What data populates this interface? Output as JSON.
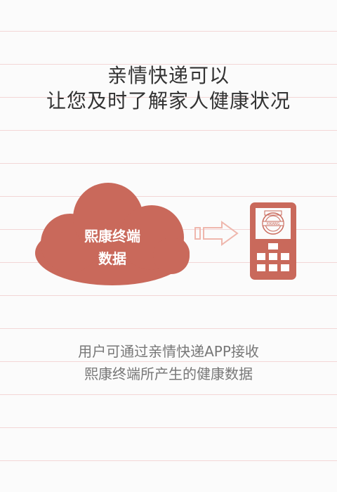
{
  "headline": {
    "line1": "亲情快递可以",
    "line2": "让您及时了解家人健康状况"
  },
  "cloud": {
    "line1": "熙康终端",
    "line2": "数据",
    "color": "#c9695b"
  },
  "phone": {
    "color": "#c9695b",
    "screen_stamp_text": "XIKANG"
  },
  "caption": {
    "line1": "用户可通过亲情快递APP接收",
    "line2": "熙康终端所产生的健康数据"
  }
}
